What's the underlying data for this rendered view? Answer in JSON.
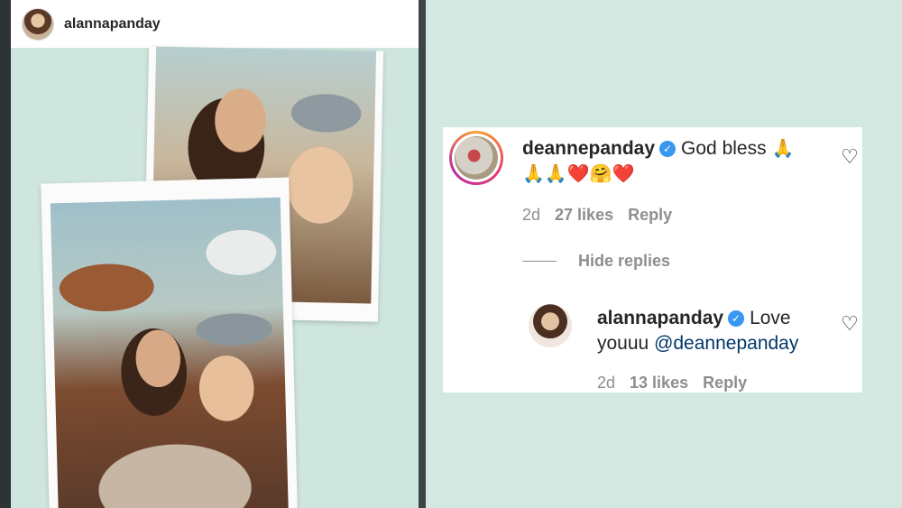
{
  "post": {
    "username": "alannapanday"
  },
  "comment": {
    "username": "deannepanday",
    "text": "God bless",
    "emojis_line1": "🙏",
    "emojis_line2": "🙏🙏❤️🤗❤️",
    "time": "2d",
    "likes": "27 likes",
    "reply_label": "Reply",
    "hide_replies_label": "Hide replies"
  },
  "reply": {
    "username": "alannapanday",
    "text": "Love youuu",
    "mention": "@deannepanday",
    "time": "2d",
    "likes": "13 likes",
    "reply_label": "Reply"
  },
  "icons": {
    "verified": "✓",
    "heart": "♡"
  },
  "colors": {
    "background": "#d2e8e0",
    "verified_blue": "#3897f0",
    "mention_blue": "#00376b",
    "meta_gray": "#8e8e8e"
  }
}
